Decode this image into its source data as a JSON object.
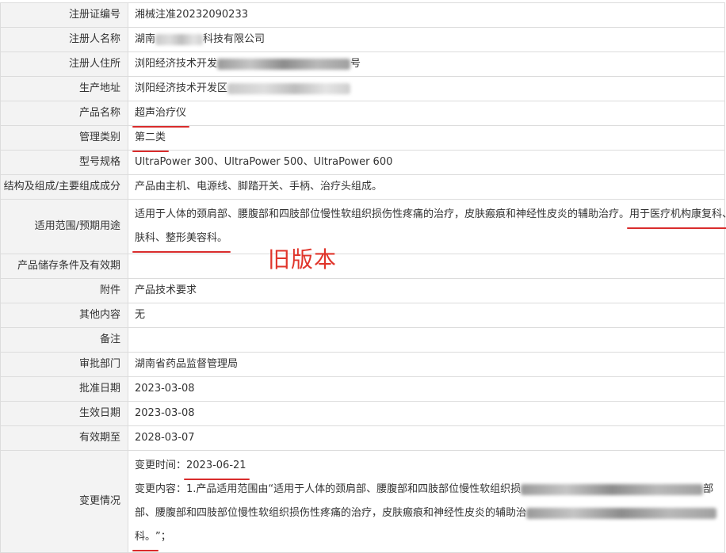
{
  "rows": {
    "reg_no": {
      "label": "注册证编号",
      "value": "湘械注准20232090233"
    },
    "registrant": {
      "label": "注册人名称",
      "value_prefix": "湖南",
      "value_suffix": "科技有限公司"
    },
    "registrant_address": {
      "label": "注册人住所",
      "value_prefix": "浏阳经济技术开发",
      "value_suffix": "号"
    },
    "production_address": {
      "label": "生产地址",
      "value_prefix": "浏阳经济技术开发区"
    },
    "product_name": {
      "label": "产品名称",
      "value": "超声治疗仪"
    },
    "category": {
      "label": "管理类别",
      "value": "第二类"
    },
    "model": {
      "label": "型号规格",
      "value": "UltraPower 300、UltraPower 500、UltraPower 600"
    },
    "structure": {
      "label": "结构及组成/主要组成成分",
      "value": "产品由主机、电源线、脚踏开关、手柄、治疗头组成。"
    },
    "scope": {
      "label": "适用范围/预期用途",
      "value_main": "适用于人体的颈肩部、腰腹部和四肢部位慢性软组织损伤性疼痛的治疗，皮肤瘢痕和神经性皮炎的辅助治疗。",
      "value_hl1": "用于医疗机构康复科、皮",
      "value_hl2": "肤科、整形美容科。"
    },
    "storage": {
      "label": "产品储存条件及有效期",
      "value": ""
    },
    "attachment": {
      "label": "附件",
      "value": "产品技术要求"
    },
    "other": {
      "label": "其他内容",
      "value": "无"
    },
    "remark": {
      "label": "备注",
      "value": ""
    },
    "authority": {
      "label": "审批部门",
      "value": "湖南省药品监督管理局"
    },
    "approval_date": {
      "label": "批准日期",
      "value": "2023-03-08"
    },
    "effective_date": {
      "label": "生效日期",
      "value": "2023-03-08"
    },
    "expiry_date": {
      "label": "有效期至",
      "value": "2028-03-07"
    },
    "change": {
      "label": "变更情况",
      "time_label": "变更时间：",
      "time_value": "2023-06-21",
      "content_line1": "变更内容：1.产品适用范围由“适用于人体的颈肩部、腰腹部和四肢部位慢性软组织损",
      "content_line1_tail": "部",
      "content_line2": "部、腰腹部和四肢部位慢性软组织损伤性疼痛的治疗，皮肤瘢痕和神经性皮炎的辅助治",
      "content_line3_hl": "科。",
      "content_line3_tail": "”；"
    }
  },
  "annotation": {
    "text": "旧版本",
    "color": "#e0352b"
  },
  "colors": {
    "label_bg": "#f3f3f3",
    "border": "#dcdcdc",
    "underline": "#d92c2c"
  }
}
